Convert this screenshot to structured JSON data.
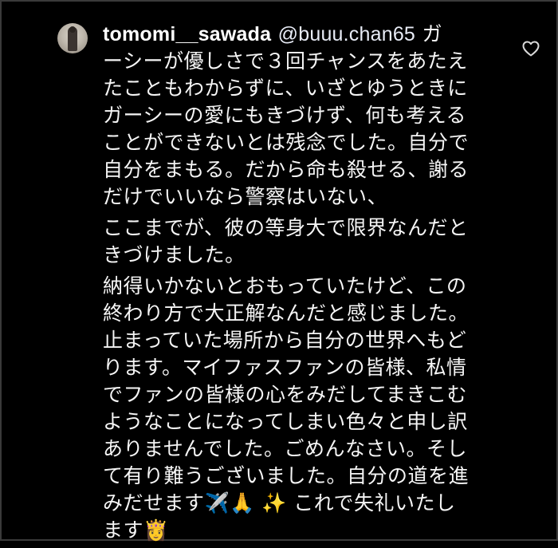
{
  "comment": {
    "username": "tomomi__sawada",
    "mention": "@buuu.chan65",
    "paragraphs": [
      [
        "ガ",
        "ーシーが優しさで３回チャンスをあたえ",
        "たこともわからずに、いざとゆうときに",
        "ガーシーの愛にもきづけず、何も考える",
        "ことができないとは残念でした。自分で",
        "自分をまもる。だから命も殺せる、謝る",
        "だけでいいなら警察はいない、"
      ],
      [
        "ここまでが、彼の等身大で限界なんだと",
        "きづけました。"
      ],
      [
        "納得いかないとおもっていたけど、この",
        "終わり方で大正解なんだと感じました。",
        "止まっていた場所から自分の世界へもど",
        "ります。マイファスファンの皆様、私情",
        "でファンの皆様の心をみだしてまきこむ",
        "ようなことになってしまい色々と申し訳",
        "ありませんでした。ごめんなさい。そし",
        "て有り難うございました。自分の道を進",
        "みだせます✈️🙏 ✨ これで失礼いたし",
        "ます👸"
      ]
    ]
  },
  "icons": {
    "avatar": "profile-avatar",
    "like": "heart-outline-icon"
  },
  "colors": {
    "background": "#000000",
    "text": "#f5f5f5",
    "border": "#3a3a3a"
  }
}
